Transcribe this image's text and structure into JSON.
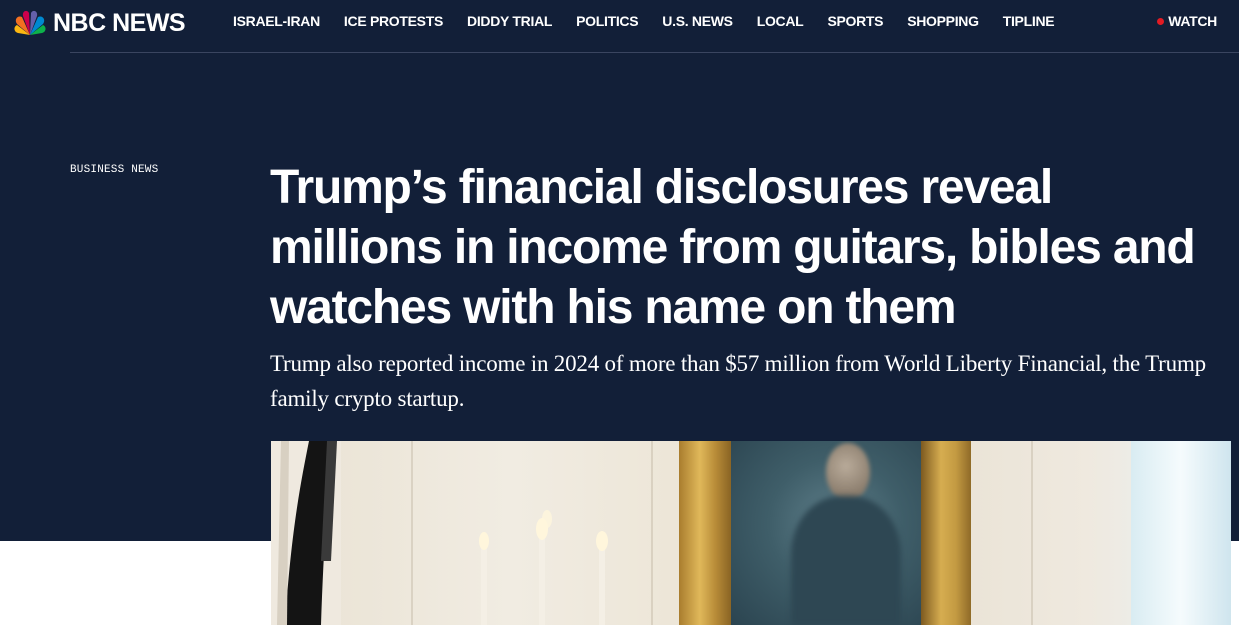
{
  "brand": {
    "name": "NBC NEWS",
    "logo_icon": "peacock-icon",
    "colors": {
      "background": "#121f38",
      "peacock": [
        "#fcb711",
        "#f37021",
        "#cc004c",
        "#6460aa",
        "#0089d0",
        "#0db14b"
      ],
      "live": "#e31b23"
    }
  },
  "nav": {
    "items": [
      {
        "label": "ISRAEL-IRAN"
      },
      {
        "label": "ICE PROTESTS"
      },
      {
        "label": "DIDDY TRIAL"
      },
      {
        "label": "POLITICS"
      },
      {
        "label": "U.S. NEWS"
      },
      {
        "label": "LOCAL"
      },
      {
        "label": "SPORTS"
      },
      {
        "label": "SHOPPING"
      },
      {
        "label": "TIPLINE"
      }
    ],
    "watch_label": "WATCH"
  },
  "article": {
    "section": "BUSINESS NEWS",
    "headline": "Trump’s financial disclosures reveal millions in income from guitars, bibles and watches with his name on them",
    "dek": "Trump also reported income in 2024 of more than $57 million from World Liberty Financial, the Trump family crypto startup."
  }
}
